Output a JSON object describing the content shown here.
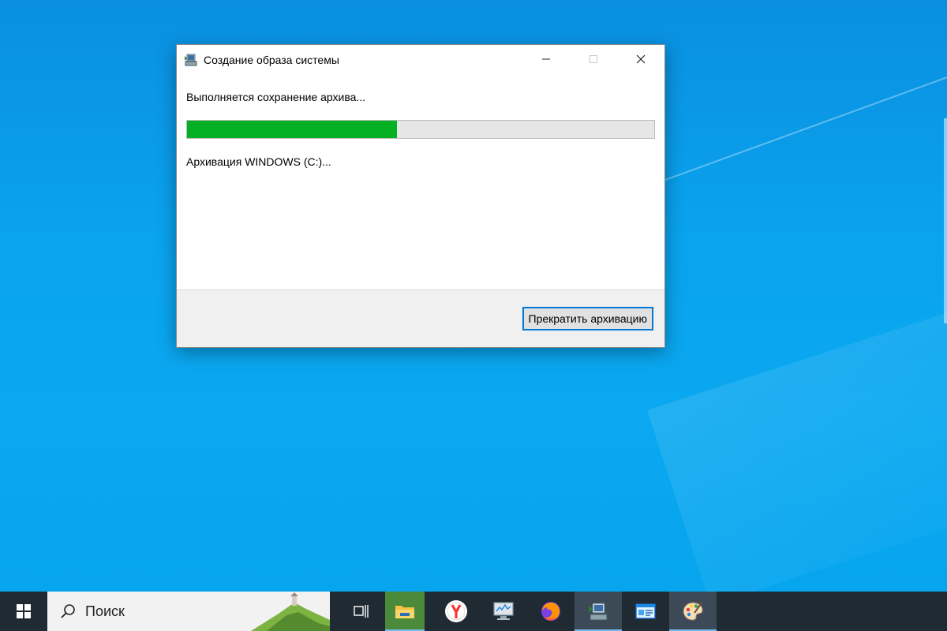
{
  "window": {
    "title": "Создание образа системы",
    "icon": "system-image-backup-icon",
    "controls": {
      "minimize": "minimize-icon",
      "maximize": "maximize-icon",
      "close": "close-icon"
    }
  },
  "dialog": {
    "status": "Выполняется сохранение архива...",
    "progress_fraction": 0.45,
    "progress_color": "#06b025",
    "detail": "Архивация WINDOWS (C:)...",
    "stop_button": "Прекратить архивацию"
  },
  "taskbar": {
    "search_placeholder": "Поиск",
    "items": [
      {
        "icon": "task-view-icon"
      },
      {
        "icon": "file-explorer-icon"
      },
      {
        "icon": "yandex-browser-icon"
      },
      {
        "icon": "system-monitor-icon"
      },
      {
        "icon": "firefox-icon"
      },
      {
        "icon": "backup-app-icon",
        "active": true
      },
      {
        "icon": "control-panel-icon"
      },
      {
        "icon": "paint-icon"
      }
    ]
  },
  "colors": {
    "desktop": "#0aa3ee",
    "accent": "#0078d7",
    "taskbar": "#1f2a33"
  }
}
